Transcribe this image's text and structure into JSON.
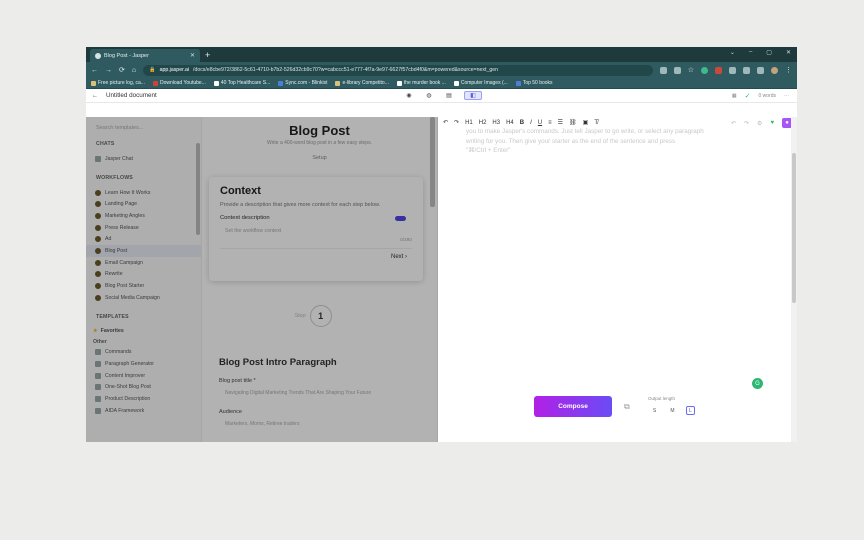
{
  "browser": {
    "tab_title": "Blog Post - Jasper",
    "url_host": "app.jasper.ai",
    "url_rest": "/docs/e8cbe972/3862-5c61-4710-b7b2-526d32cb9c70?w=cabccc51-e777-4f7a-9e97-6627f57cbd4f0&m=powered&source=next_gen",
    "bookmarks": [
      "Free picture log, ca...",
      "Download Youtube...",
      "40 Top Healthcare S...",
      "Sync.com - Blinkist",
      "e-library Competito...",
      "the murder book ...",
      "Computer Images (...",
      "Top 50 books"
    ]
  },
  "app": {
    "doc_title": "Untitled document",
    "word_count": "0 words"
  },
  "sidebar": {
    "search_placeholder": "Search templates...",
    "chats_heading": "CHATS",
    "chat_item": "Jasper Chat",
    "workflows_heading": "WORKFLOWS",
    "workflows": [
      "Learn How It Works",
      "Landing Page",
      "Marketing Angles",
      "Press Release",
      "Ad",
      "Blog Post",
      "Email Campaign",
      "Rewrite",
      "Blog Post Starter",
      "Social Media Campaign"
    ],
    "templates_heading": "TEMPLATES",
    "favorites_label": "Favorites",
    "other_label": "Other",
    "templates": [
      "Commands",
      "Paragraph Generator",
      "Content Improver",
      "One-Shot Blog Post",
      "Product Description",
      "AIDA Framework"
    ]
  },
  "workflow": {
    "title": "Blog Post",
    "subtitle": "Write a 400-word blog post in a few easy steps.",
    "setup_label": "Setup",
    "card_title": "Context",
    "card_desc": "Provide a description that gives more context for each step below.",
    "context_label": "Context description",
    "context_placeholder": "Set the workflow context",
    "char_count": "0/280",
    "next_label": "Next",
    "step_label": "Step",
    "step_number": "1",
    "intro_heading": "Blog Post Intro Paragraph",
    "title_label": "Blog post title *",
    "title_placeholder": "Navigating Digital Marketing Trends That Are Shaping Your Future",
    "audience_label": "Audience",
    "audience_placeholder": "Marketers, Moms, Retiree traders"
  },
  "editor": {
    "toolbar": [
      "H1",
      "H2",
      "H3",
      "H4",
      "B",
      "I",
      "U"
    ],
    "placeholder_line1": "you to make Jasper's commands. Just tell Jasper to go write, or select any paragraph",
    "placeholder_line2": "writing for you. Then give your starter as the end of the sentence and press",
    "placeholder_line3": "\"⌘/Ctrl + Enter\"",
    "compose_label": "Compose",
    "output_length_label": "Output length",
    "sizes": [
      "S",
      "M",
      "L"
    ]
  },
  "colors": {
    "browser_chrome": "#2f5b60",
    "accent": "#4f46e5",
    "compose_start": "#b220e6",
    "compose_end": "#6a4cf5",
    "success": "#2bb673"
  }
}
